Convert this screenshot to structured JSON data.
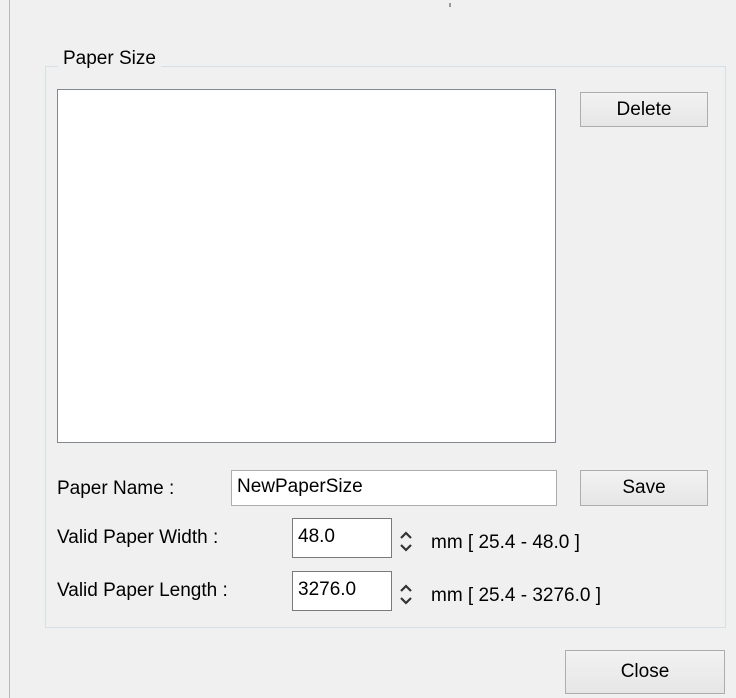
{
  "group": {
    "title": "Paper Size"
  },
  "paper_list": {
    "items": []
  },
  "buttons": {
    "delete_label": "Delete",
    "save_label": "Save",
    "close_label": "Close"
  },
  "paper_name": {
    "label": "Paper Name :",
    "value": "NewPaperSize"
  },
  "paper_width": {
    "label": "Valid Paper Width :",
    "value": "48.0",
    "range": "mm [ 25.4 - 48.0 ]"
  },
  "paper_length": {
    "label": "Valid Paper Length :",
    "value": "3276.0",
    "range": "mm [ 25.4 - 3276.0 ]"
  },
  "icons": {
    "width_spinner": "up-down-spinner-icon",
    "length_spinner": "up-down-spinner-icon"
  }
}
